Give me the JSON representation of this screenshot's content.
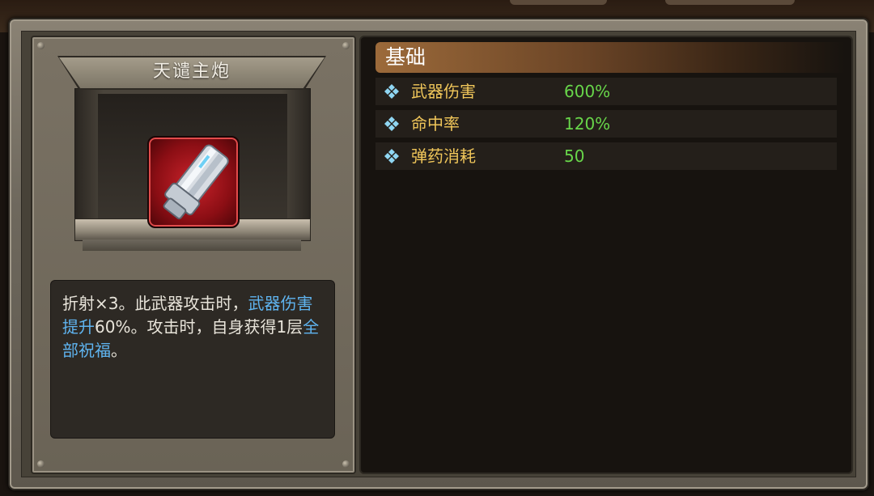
{
  "weapon": {
    "name": "天谴主炮",
    "icon": "cannon-icon",
    "description": {
      "part1": "折射×3。此武器攻击时，",
      "highlight1": "武器伤害提升",
      "part2": "60%。攻击时，自身获得1层",
      "highlight2": "全部祝福",
      "part3": "。"
    }
  },
  "stats_section": {
    "title": "基础",
    "rows": [
      {
        "label": "武器伤害",
        "value": "600%"
      },
      {
        "label": "命中率",
        "value": "120%"
      },
      {
        "label": "弹药消耗",
        "value": "50"
      }
    ]
  },
  "colors": {
    "stat_label": "#f0c65a",
    "stat_value": "#68d64a",
    "highlight": "#5fb4f0",
    "icon_bg": "#c9232b"
  }
}
